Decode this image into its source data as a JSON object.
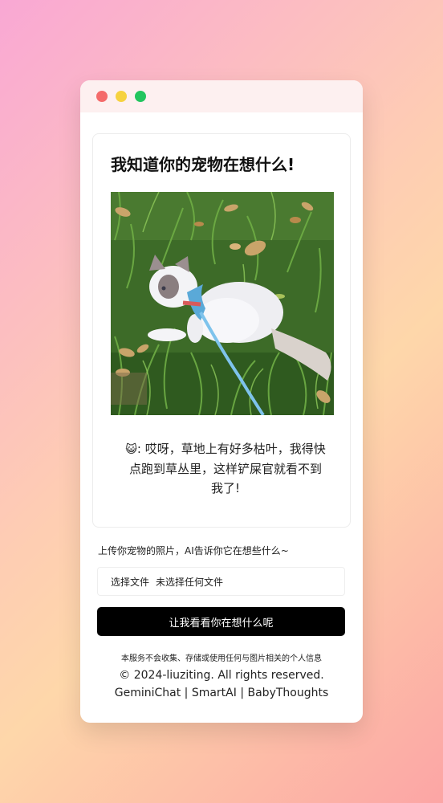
{
  "app": {
    "title": "我知道你的宠物在想什么!",
    "thought_emoji": "😺",
    "thought_text": ": 哎呀，草地上有好多枯叶，我得快点跑到草丛里，这样铲屎官就看不到我了!"
  },
  "upload": {
    "hint": "上传你宠物的照片，AI告诉你它在想些什么~",
    "choose_file_label": "选择文件",
    "no_file_label": "未选择任何文件",
    "submit_label": "让我看看你在想什么呢"
  },
  "footer": {
    "privacy": "本服务不会收集、存储或使用任何与图片相关的个人信息",
    "copyright": "© 2024-liuziting. All rights reserved.",
    "links": "GeminiChat | SmartAI | BabyThoughts"
  },
  "colors": {
    "dot_red": "#f46b6b",
    "dot_yellow": "#f6d23f",
    "dot_green": "#22c55e",
    "button_bg": "#000000"
  },
  "icons": {
    "pet_photo": "cat-on-grass-image"
  }
}
